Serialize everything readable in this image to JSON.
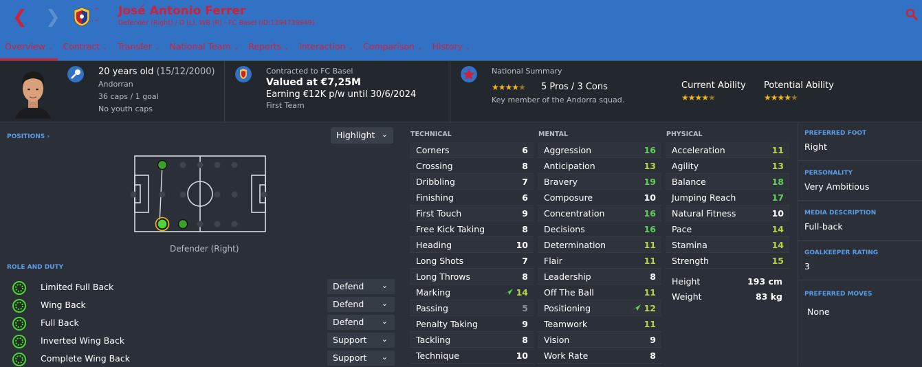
{
  "header": {
    "player_name": "José Antonio Ferrer",
    "subtitle": "Defender (Right) / D (L), WB (R) - FC Basel (ID:1394739949)",
    "back_icon": "chevron-left-icon",
    "forward_icon": "chevron-right-icon",
    "search_icon": "search-icon",
    "accent_color": "#d0213a",
    "bar_color": "#3172c4"
  },
  "tabs": [
    {
      "label": "Overview"
    },
    {
      "label": "Contract"
    },
    {
      "label": "Transfer"
    },
    {
      "label": "National Team"
    },
    {
      "label": "Reports"
    },
    {
      "label": "Interaction"
    },
    {
      "label": "Comparison"
    },
    {
      "label": "History"
    }
  ],
  "info": {
    "age": "20 years old",
    "dob": "(15/12/2000)",
    "nationality": "Andorran",
    "caps": "36 caps / 1 goal",
    "youth_caps": "No youth caps",
    "contract_header": "Contracted to FC Basel",
    "value": "Valued at €7,25M",
    "wage": "Earning €12K p/w until 30/6/2024",
    "squad_status": "First Team",
    "national_header": "National Summary",
    "national_pros": "5 Pros / 3 Cons",
    "national_role": "Key member of the Andorra squad.",
    "current_ability_label": "Current Ability",
    "potential_ability_label": "Potential Ability",
    "national_rating": 4.5,
    "current_ability_stars": 4.5,
    "potential_ability_stars": 4.5
  },
  "left": {
    "positions_label": "POSITIONS",
    "highlight_label": "Highlight",
    "position_caption": "Defender (Right)",
    "role_label": "ROLE AND DUTY",
    "roles": [
      {
        "name": "Limited Full Back",
        "duty": "Defend"
      },
      {
        "name": "Wing Back",
        "duty": "Defend"
      },
      {
        "name": "Full Back",
        "duty": "Defend"
      },
      {
        "name": "Inverted Wing Back",
        "duty": "Support"
      },
      {
        "name": "Complete Wing Back",
        "duty": "Support"
      }
    ]
  },
  "attributes": {
    "technical_label": "TECHNICAL",
    "mental_label": "MENTAL",
    "physical_label": "PHYSICAL",
    "technical": [
      {
        "name": "Corners",
        "value": "6"
      },
      {
        "name": "Crossing",
        "value": "8"
      },
      {
        "name": "Dribbling",
        "value": "7"
      },
      {
        "name": "Finishing",
        "value": "6"
      },
      {
        "name": "First Touch",
        "value": "9"
      },
      {
        "name": "Free Kick Taking",
        "value": "8"
      },
      {
        "name": "Heading",
        "value": "10"
      },
      {
        "name": "Long Shots",
        "value": "7"
      },
      {
        "name": "Long Throws",
        "value": "8"
      },
      {
        "name": "Marking",
        "value": "14",
        "arrow": true
      },
      {
        "name": "Passing",
        "value": "5"
      },
      {
        "name": "Penalty Taking",
        "value": "9"
      },
      {
        "name": "Tackling",
        "value": "8"
      },
      {
        "name": "Technique",
        "value": "10"
      }
    ],
    "mental": [
      {
        "name": "Aggression",
        "value": "16"
      },
      {
        "name": "Anticipation",
        "value": "13"
      },
      {
        "name": "Bravery",
        "value": "19"
      },
      {
        "name": "Composure",
        "value": "10"
      },
      {
        "name": "Concentration",
        "value": "16"
      },
      {
        "name": "Decisions",
        "value": "16"
      },
      {
        "name": "Determination",
        "value": "11"
      },
      {
        "name": "Flair",
        "value": "11"
      },
      {
        "name": "Leadership",
        "value": "8"
      },
      {
        "name": "Off The Ball",
        "value": "11"
      },
      {
        "name": "Positioning",
        "value": "12",
        "arrow": true
      },
      {
        "name": "Teamwork",
        "value": "11"
      },
      {
        "name": "Vision",
        "value": "9"
      },
      {
        "name": "Work Rate",
        "value": "8"
      }
    ],
    "physical": [
      {
        "name": "Acceleration",
        "value": "11"
      },
      {
        "name": "Agility",
        "value": "13"
      },
      {
        "name": "Balance",
        "value": "18"
      },
      {
        "name": "Jumping Reach",
        "value": "17"
      },
      {
        "name": "Natural Fitness",
        "value": "10"
      },
      {
        "name": "Pace",
        "value": "14"
      },
      {
        "name": "Stamina",
        "value": "14"
      },
      {
        "name": "Strength",
        "value": "15"
      }
    ],
    "height_label": "Height",
    "height_value": "193 cm",
    "weight_label": "Weight",
    "weight_value": "83 kg",
    "colors": {
      "low": "#8a8f97",
      "mid": "#ffffff",
      "good": "#b5d44a",
      "high": "#5ed158"
    }
  },
  "right": {
    "foot_label": "PREFERRED FOOT",
    "foot_value": "Right",
    "personality_label": "PERSONALITY",
    "personality_value": "Very Ambitious",
    "media_label": "MEDIA DESCRIPTION",
    "media_value": "Full-back",
    "gk_label": "GOALKEEPER RATING",
    "gk_value": "3",
    "moves_label": "PREFERRED MOVES",
    "moves_value": "None"
  }
}
